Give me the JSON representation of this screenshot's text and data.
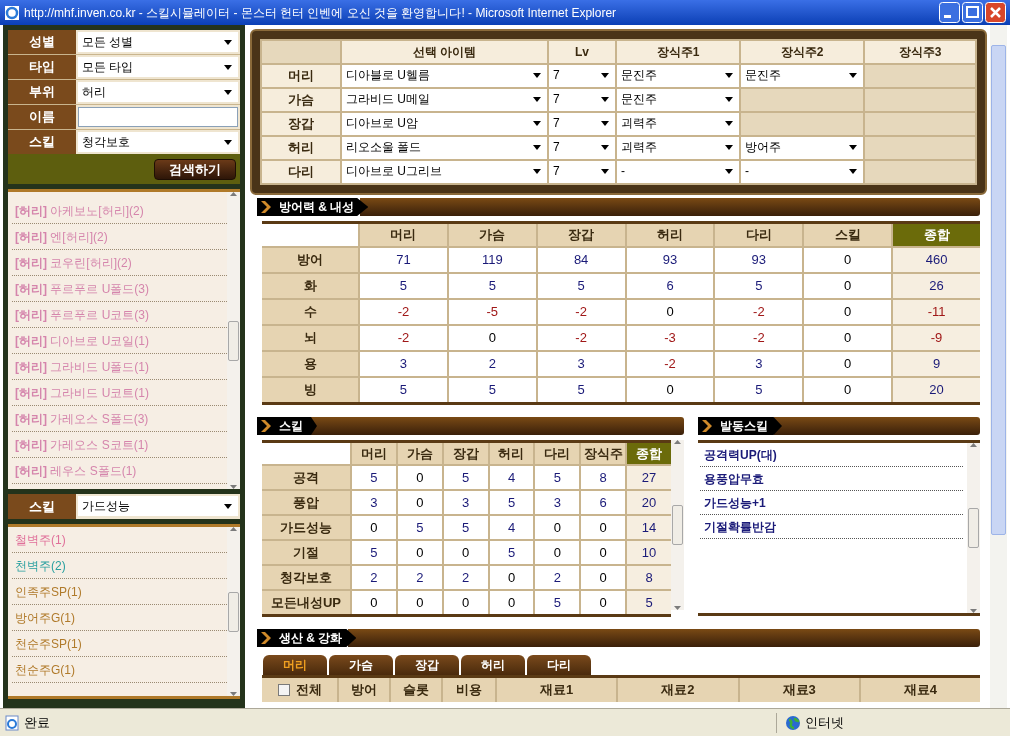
{
  "window": {
    "title": "http://mhf.inven.co.kr - 스킬시뮬레이터 - 몬스터 헌터 인벤에 오신 것을 환영합니다! - Microsoft Internet Explorer"
  },
  "filters": [
    {
      "label": "성별",
      "kind": "select",
      "value": "모든 성별"
    },
    {
      "label": "타입",
      "kind": "select",
      "value": "모든 타입"
    },
    {
      "label": "부위",
      "kind": "select",
      "value": "허리"
    },
    {
      "label": "이름",
      "kind": "text"
    },
    {
      "label": "스킬",
      "kind": "select",
      "value": "청각보호"
    }
  ],
  "search_button": "검색하기",
  "item_list": [
    "**[허리]** 아케보노[허리](2)",
    "**[허리]** 엔[허리](2)",
    "**[허리]** 코우린[허리](2)",
    "**[허리]** 푸르푸르 U폴드(3)",
    "**[허리]** 푸르푸르 U코트(3)",
    "**[허리]** 디아브로 U코일(1)",
    "**[허리]** 그라비드 U폴드(1)",
    "**[허리]** 그라비드 U코트(1)",
    "**[허리]** 가레오스 S폴드(3)",
    "**[허리]** 가레오스 S코트(1)",
    "**[허리]** 레우스 S폴드(1)"
  ],
  "skill_filter": {
    "label": "스킬",
    "value": "가드성능"
  },
  "jewel_list": [
    {
      "text": "철벽주(1)",
      "color": "#e0709a"
    },
    {
      "text": "천벽주(2)",
      "color": "#2aa0a0"
    },
    {
      "text": "인족주SP(1)",
      "color": "#b07a2a"
    },
    {
      "text": "방어주G(1)",
      "color": "#b07a2a"
    },
    {
      "text": "천순주SP(1)",
      "color": "#b07a2a"
    },
    {
      "text": "천순주G(1)",
      "color": "#b07a2a"
    }
  ],
  "equipment": {
    "columns": [
      "선택 아이템",
      "Lv",
      "장식주1",
      "장식주2",
      "장식주3"
    ],
    "rows": [
      {
        "part": "머리",
        "item": "디아블로 U헬름",
        "lv": "7",
        "jewels": [
          "문진주",
          "문진주"
        ]
      },
      {
        "part": "가슴",
        "item": "그라비드 U메일",
        "lv": "7",
        "jewels": [
          "문진주"
        ]
      },
      {
        "part": "장갑",
        "item": "디아브로 U암",
        "lv": "7",
        "jewels": [
          "괴력주"
        ]
      },
      {
        "part": "허리",
        "item": "리오소울 폴드",
        "lv": "7",
        "jewels": [
          "괴력주",
          "방어주"
        ]
      },
      {
        "part": "다리",
        "item": "디아브로 U그리브",
        "lv": "7",
        "jewels": [
          "-",
          "-"
        ]
      }
    ]
  },
  "defense": {
    "title": "방어력 & 내성",
    "columns": [
      "머리",
      "가슴",
      "장갑",
      "허리",
      "다리",
      "스킬",
      "종합"
    ],
    "rows": [
      {
        "label": "방어",
        "values": [
          "71",
          "119",
          "84",
          "93",
          "93",
          "0",
          "460"
        ]
      },
      {
        "label": "화",
        "values": [
          "5",
          "5",
          "5",
          "6",
          "5",
          "0",
          "26"
        ]
      },
      {
        "label": "수",
        "values": [
          "-2",
          "-5",
          "-2",
          "0",
          "-2",
          "0",
          "-11"
        ]
      },
      {
        "label": "뇌",
        "values": [
          "-2",
          "0",
          "-2",
          "-3",
          "-2",
          "0",
          "-9"
        ]
      },
      {
        "label": "용",
        "values": [
          "3",
          "2",
          "3",
          "-2",
          "3",
          "0",
          "9"
        ]
      },
      {
        "label": "빙",
        "values": [
          "5",
          "5",
          "5",
          "0",
          "5",
          "0",
          "20"
        ]
      }
    ]
  },
  "skills": {
    "title": "스킬",
    "columns": [
      "머리",
      "가슴",
      "장갑",
      "허리",
      "다리",
      "장식주",
      "종합"
    ],
    "rows": [
      {
        "label": "공격",
        "values": [
          "5",
          "0",
          "5",
          "4",
          "5",
          "8",
          "27"
        ]
      },
      {
        "label": "풍압",
        "values": [
          "3",
          "0",
          "3",
          "5",
          "3",
          "6",
          "20"
        ]
      },
      {
        "label": "가드성능",
        "values": [
          "0",
          "5",
          "5",
          "4",
          "0",
          "0",
          "14"
        ]
      },
      {
        "label": "기절",
        "values": [
          "5",
          "0",
          "0",
          "5",
          "0",
          "0",
          "10"
        ]
      },
      {
        "label": "청각보호",
        "values": [
          "2",
          "2",
          "2",
          "0",
          "2",
          "0",
          "8"
        ]
      },
      {
        "label": "모든내성UP",
        "values": [
          "0",
          "0",
          "0",
          "0",
          "5",
          "0",
          "5"
        ]
      }
    ]
  },
  "active_skills": {
    "title": "발동스킬",
    "items": [
      "공격력UP(대)",
      "용풍압무효",
      "가드성능+1",
      "기절확률반감"
    ]
  },
  "crafting": {
    "title": "생산 & 강화",
    "tabs": [
      {
        "label": "머리",
        "selected": true
      },
      {
        "label": "가슴",
        "selected": false
      },
      {
        "label": "장갑",
        "selected": false
      },
      {
        "label": "허리",
        "selected": false
      },
      {
        "label": "다리",
        "selected": false
      }
    ],
    "select_all": {
      "label": "전체",
      "checked": false
    },
    "columns": [
      "방어",
      "슬롯",
      "비용",
      "재료1",
      "재료2",
      "재료3",
      "재료4"
    ]
  },
  "status_bar": {
    "text": "완료",
    "zone": "인터넷"
  }
}
